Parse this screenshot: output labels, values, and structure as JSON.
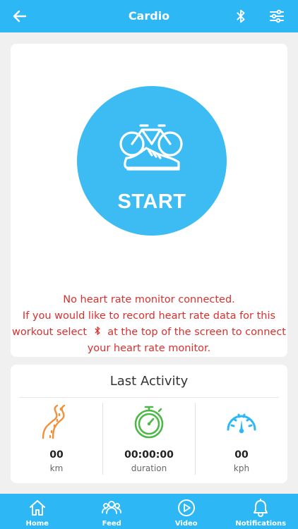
{
  "header": {
    "title": "Cardio",
    "back_icon": "arrow-left-icon",
    "bluetooth_icon": "bluetooth-icon",
    "settings_icon": "sliders-icon"
  },
  "start": {
    "label": "START",
    "icon": "bike-shoe-icon"
  },
  "warning": {
    "line1": "No heart rate monitor connected.",
    "line2": "If you would like to record heart rate data for this",
    "line3_before": "workout select",
    "line3_after": "at the top of the screen to connect",
    "line4": "your heart rate monitor."
  },
  "last_activity": {
    "title": "Last Activity",
    "stats": [
      {
        "value": "00",
        "unit": "km",
        "icon": "road-icon"
      },
      {
        "value": "00:00:00",
        "unit": "duration",
        "icon": "stopwatch-icon"
      },
      {
        "value": "00",
        "unit": "kph",
        "icon": "speedometer-icon"
      }
    ]
  },
  "tabs": [
    {
      "label": "Home",
      "icon": "home-icon"
    },
    {
      "label": "Feed",
      "icon": "people-icon"
    },
    {
      "label": "Video",
      "icon": "play-icon"
    },
    {
      "label": "Notifications",
      "icon": "bell-icon"
    }
  ],
  "colors": {
    "primary": "#2db7f5",
    "start_fill": "#3cbcf3",
    "ring": "#f3e81c",
    "warning": "#d9302f",
    "road": "#f0913a",
    "stopwatch": "#4cb848",
    "speedometer": "#2db7f5"
  }
}
